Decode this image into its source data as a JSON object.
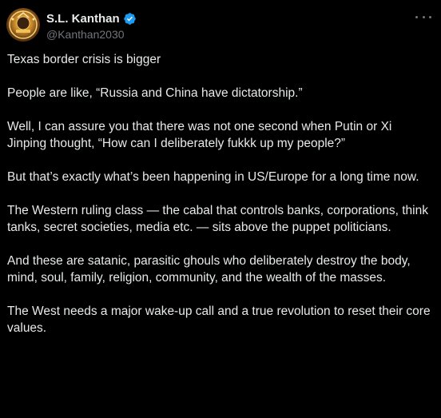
{
  "author": {
    "display_name": "S.L. Kanthan",
    "handle": "@Kanthan2030",
    "verified_icon": "verified-badge-icon",
    "avatar_icon": "avatar-emblem",
    "accent_color": "#1d9bf0"
  },
  "menu": {
    "more_icon": "more-options-icon"
  },
  "tweet": {
    "paragraphs": [
      "Texas border crisis is bigger",
      "People are like, “Russia and China have dictatorship.”",
      "Well, I can assure you that there was not one second when Putin or Xi Jinping thought, “How can I deliberately fukkk up my people?”",
      "But that’s exactly what’s been happening in US/Europe for a long time now.",
      "The Western ruling class — the cabal that controls banks, corporations, think tanks, secret societies, media etc. — sits above the puppet politicians.",
      "And these are satanic, parasitic ghouls who deliberately destroy the body, mind, soul, family, religion, community, and the wealth of the masses.",
      "The West needs a major wake-up call and a true revolution to reset their core values."
    ]
  }
}
